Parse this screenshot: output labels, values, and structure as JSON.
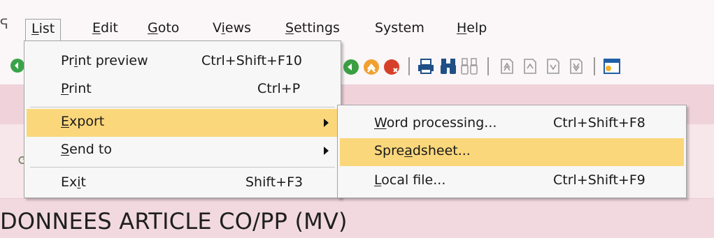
{
  "menubar": {
    "items": [
      {
        "label": "List",
        "mnemonic": "L",
        "rest": "ist"
      },
      {
        "label": "Edit",
        "mnemonic": "E",
        "rest": "dit"
      },
      {
        "label": "Goto",
        "mnemonic": "G",
        "rest": "oto"
      },
      {
        "label": "Views",
        "pre": "V",
        "mnemonic": "i",
        "rest": "ews"
      },
      {
        "label": "Settings",
        "mnemonic": "S",
        "rest": "ettings"
      },
      {
        "label": "System",
        "mnemonic": "",
        "rest": "System"
      },
      {
        "label": "Help",
        "mnemonic": "H",
        "rest": "elp"
      }
    ]
  },
  "list_menu": {
    "items": [
      {
        "pre": "Pr",
        "mnemonic": "i",
        "rest": "nt preview",
        "shortcut": "Ctrl+Shift+F10"
      },
      {
        "pre": "",
        "mnemonic": "P",
        "rest": "rint",
        "shortcut": "Ctrl+P"
      },
      {
        "pre": "",
        "mnemonic": "E",
        "rest": "xport",
        "shortcut": ""
      },
      {
        "pre": "",
        "mnemonic": "S",
        "rest": "end to",
        "shortcut": ""
      },
      {
        "pre": "Ex",
        "mnemonic": "i",
        "rest": "t",
        "shortcut": "Shift+F3"
      }
    ]
  },
  "export_menu": {
    "items": [
      {
        "pre": "",
        "mnemonic": "W",
        "rest": "ord processing...",
        "shortcut": "Ctrl+Shift+F8"
      },
      {
        "pre": "Spre",
        "mnemonic": "a",
        "rest": "dsheet...",
        "shortcut": ""
      },
      {
        "pre": "",
        "mnemonic": "L",
        "rest": "ocal file...",
        "shortcut": "Ctrl+Shift+F9"
      }
    ]
  },
  "page": {
    "title": "DONNEES ARTICLE CO/PP (MV)"
  },
  "colors": {
    "highlight": "#fbd77b",
    "menu_bg": "#f7f7f7",
    "page_bg": "#f1d9df"
  },
  "icons": [
    "app-glyph-icon",
    "back-icon",
    "exit-icon",
    "cancel-icon",
    "print-icon",
    "find-icon",
    "find-next-icon",
    "first-page-icon",
    "previous-page-icon",
    "next-page-icon",
    "last-page-icon",
    "create-session-icon"
  ]
}
